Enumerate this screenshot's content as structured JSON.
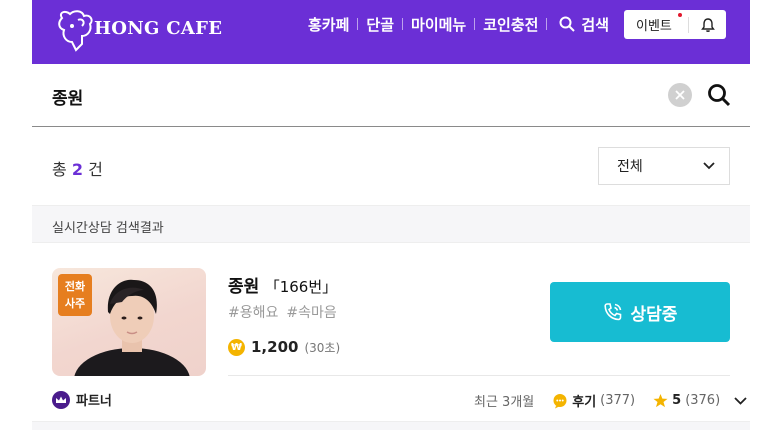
{
  "header": {
    "brand": "HONG CAFE",
    "nav": [
      "홍카페",
      "단골",
      "마이메뉴",
      "코인충전"
    ],
    "search_label": "검색",
    "event_label": "이벤트",
    "colors": {
      "primary": "#6b2fd6",
      "accent": "#17bcd2"
    }
  },
  "search": {
    "query": "종원"
  },
  "results": {
    "count_prefix": "총",
    "count": "2",
    "count_suffix": "건",
    "filter_value": "전체"
  },
  "section": {
    "title": "실시간상담 검색결과"
  },
  "card": {
    "badge_line1": "전화",
    "badge_line2": "사주",
    "name": "종원",
    "number": "「166번」",
    "tags": [
      "#용해요",
      "#속마음"
    ],
    "price": "1,200",
    "price_unit": "(30초)",
    "button_label": "상담중",
    "partner_label": "파트너",
    "period": "최근 3개월",
    "review_label": "후기",
    "review_count": "(377)",
    "rating": "5",
    "rating_count": "(376)"
  }
}
